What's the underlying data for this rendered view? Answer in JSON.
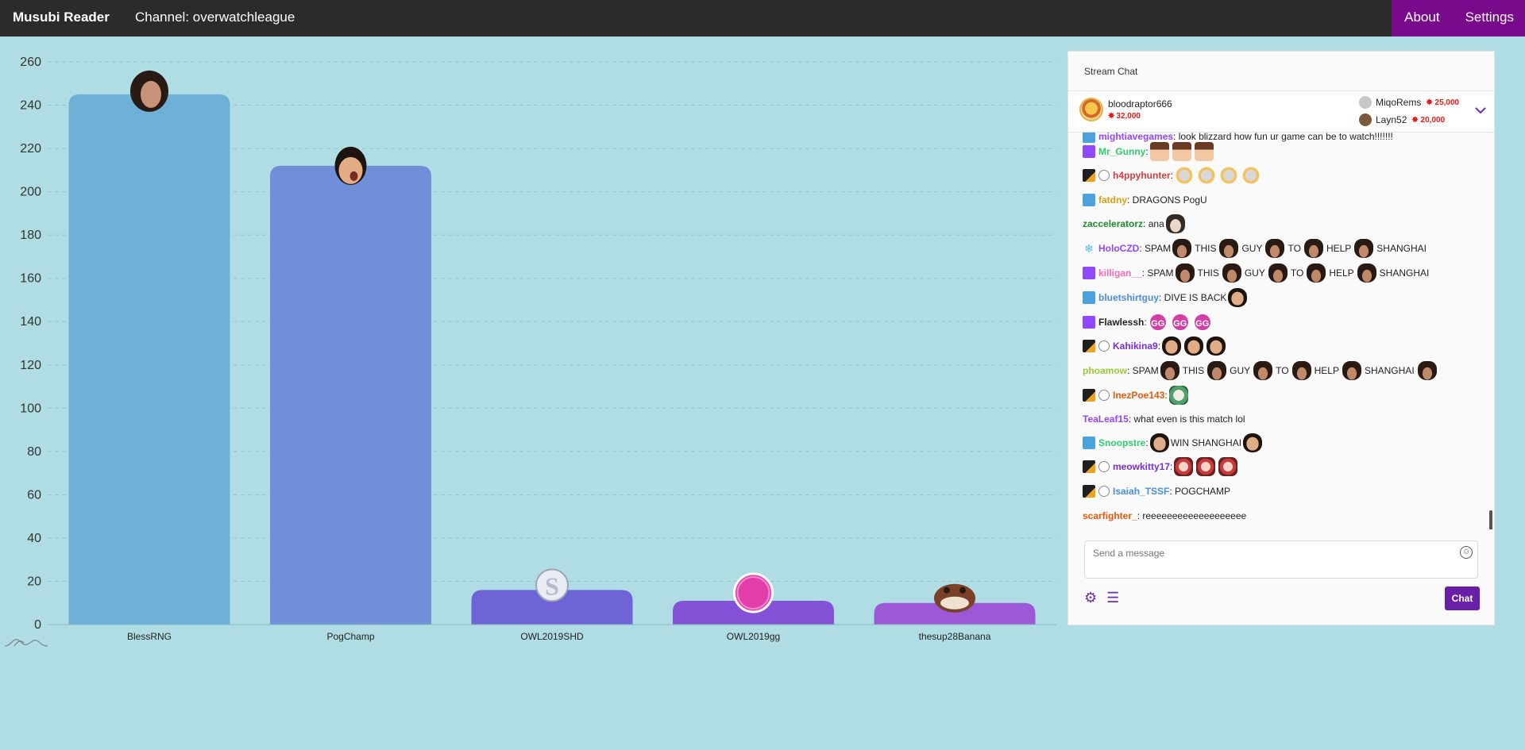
{
  "nav": {
    "brand": "Musubi Reader",
    "channel": "Channel: overwatchleague",
    "links": [
      "About",
      "Settings"
    ],
    "accent": "#7a0a8c"
  },
  "chart_data": {
    "type": "bar",
    "categories": [
      "BlessRNG",
      "PogChamp",
      "OWL2019SHD",
      "OWL2019gg",
      "thesup28Banana"
    ],
    "values": [
      245,
      212,
      16,
      11,
      10
    ],
    "ylim": [
      0,
      260
    ],
    "yticks": [
      0,
      20,
      40,
      60,
      80,
      100,
      120,
      140,
      160,
      180,
      200,
      220,
      240,
      260
    ],
    "colors": [
      "#6fb0d8",
      "#6f8fd8",
      "#6e64d6",
      "#8452d6",
      "#9c58d6"
    ],
    "emotes": [
      "bless-emote",
      "pogchamp-emote",
      "owl-shd-emote",
      "gg-emote",
      "banana-emote"
    ],
    "grid": true
  },
  "chat": {
    "header": "Stream Chat",
    "leaderboard": {
      "top": {
        "name": "bloodraptor666",
        "amount": "32,000"
      },
      "second": {
        "name": "MiqoRems",
        "amount": "25,000"
      },
      "third": {
        "name": "Layn52",
        "amount": "20,000"
      }
    },
    "messages": [
      {
        "user": "mightiavegames",
        "color": "#9146ff",
        "badges": [
          "prime"
        ],
        "text": ": look blizzard how fun ur game can be to watch!!!!!!!",
        "emotes": []
      },
      {
        "user": "Mr_Gunny",
        "color": "#2ecc71",
        "badges": [
          "turbo"
        ],
        "text": ":",
        "emotes": [
          "anime",
          "anime",
          "anime"
        ]
      },
      {
        "user": "h4ppyhunter",
        "color": "#d63b3b",
        "badges": [
          "owl",
          "team"
        ],
        "text": ":",
        "emotes": [
          "owl",
          "owl",
          "owl",
          "owl"
        ]
      },
      {
        "user": "fatdny",
        "color": "#d4a017",
        "badges": [
          "prime"
        ],
        "text": ": DRAGONS PogU",
        "emotes": []
      },
      {
        "user": "zacceleratorz",
        "color": "#1e8a2e",
        "badges": [],
        "text": ": ana",
        "emotes": [
          "ana"
        ]
      },
      {
        "user": "HoloCZD",
        "color": "#9146ff",
        "badges": [
          "snow"
        ],
        "text": ": SPAM",
        "emotes": [],
        "spam": true
      },
      {
        "user": "killigan__",
        "color": "#ff69b4",
        "badges": [
          "turbo"
        ],
        "text": ": SPAM",
        "emotes": [],
        "spam": true
      },
      {
        "user": "bluetshirtguy",
        "color": "#4a8fd9",
        "badges": [
          "prime"
        ],
        "text": ": DIVE IS BACK",
        "emotes": [
          "pog"
        ]
      },
      {
        "user": "Flawlessh",
        "color": "#222222",
        "badges": [
          "turbo"
        ],
        "text": ":",
        "emotes": [
          "gg",
          "gg",
          "gg"
        ]
      },
      {
        "user": "Kahikina9",
        "color": "#7a2fd6",
        "badges": [
          "owl",
          "team"
        ],
        "text": ":",
        "emotes": [
          "pog",
          "pog",
          "pog"
        ]
      },
      {
        "user": "phoamow",
        "color": "#9acd32",
        "badges": [],
        "text": ": SPAM",
        "emotes": [],
        "spam": true,
        "trail": true
      },
      {
        "user": "InezPoe143",
        "color": "#e8590c",
        "badges": [
          "owl",
          "team"
        ],
        "text": ":",
        "emotes": [
          "green"
        ]
      },
      {
        "user": "TeaLeaf15",
        "color": "#9146ff",
        "badges": [],
        "text": ": what even is this match lol",
        "emotes": []
      },
      {
        "user": "Snoopstre",
        "color": "#2ecc71",
        "badges": [
          "prime"
        ],
        "text": ":",
        "emotes": [
          "pog"
        ],
        "tail": "WIN SHANGHAI"
      },
      {
        "user": "meowkitty17",
        "color": "#7a2fd6",
        "badges": [
          "owl",
          "team"
        ],
        "text": ":",
        "emotes": [
          "red",
          "red",
          "red"
        ]
      },
      {
        "user": "Isaiah_TSSF",
        "color": "#4a8fd9",
        "badges": [
          "owl",
          "team"
        ],
        "text": ": POGCHAMP",
        "emotes": []
      },
      {
        "user": "scarfighter_",
        "color": "#e8590c",
        "badges": [],
        "text": ": reeeeeeeeeeeeeeeeeee",
        "emotes": []
      }
    ],
    "spam_words": [
      "THIS",
      "GUY",
      "TO",
      "HELP",
      "SHANGHAI"
    ],
    "input_placeholder": "Send a message",
    "chat_button": "Chat"
  }
}
